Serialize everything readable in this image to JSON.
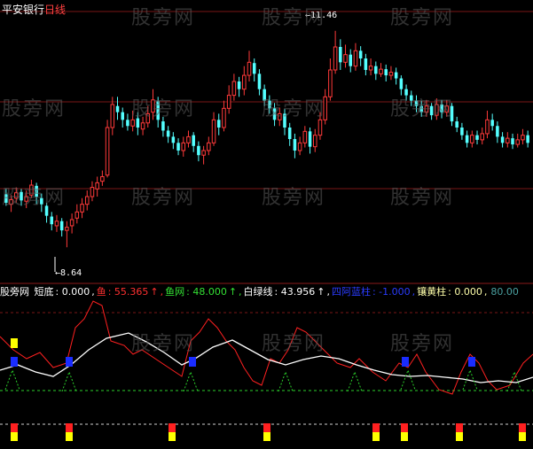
{
  "header": {
    "broker": "平安银行",
    "period": "日线"
  },
  "watermark": "股旁网",
  "colors": {
    "up": "#ff3a3a",
    "down": "#54ffff",
    "grid": "#7a1616",
    "white_line": "#ffffff",
    "green_dash": "#2bd12b",
    "yellow": "#ffff00",
    "blue": "#1a2cff",
    "red": "#ff2020"
  },
  "annotations": {
    "high": "11.46",
    "low": "8.64"
  },
  "indicator": {
    "name": "股旁网",
    "items": [
      {
        "label": "短底",
        "value": "0.000",
        "color": "#ffffff"
      },
      {
        "label": "鱼",
        "value": "55.365",
        "color": "#ff3030",
        "arrow": "↑"
      },
      {
        "label": "鱼网",
        "value": "48.000",
        "color": "#33e033",
        "arrow": "↑"
      },
      {
        "label": "白绿线",
        "value": "43.956",
        "color": "#ffffff",
        "arrow": "↑"
      },
      {
        "label": "四阿蓝柱",
        "value": "-1.000",
        "color": "#2a3cff"
      },
      {
        "label": "镶黄柱",
        "value": "0.000",
        "color": "#ffffaa"
      },
      {
        "label": "",
        "value": "80.00",
        "color": "#4aa0a0"
      }
    ]
  },
  "chart_data": {
    "type": "candlestick",
    "ylim": [
      8.4,
      11.7
    ],
    "annotations": [
      {
        "label": "11.46",
        "value": 11.46
      },
      {
        "label": "8.64",
        "value": 8.64
      }
    ],
    "candles": [
      [
        9.33,
        9.22,
        9.4,
        9.18
      ],
      [
        9.2,
        9.26,
        9.32,
        9.1
      ],
      [
        9.28,
        9.35,
        9.42,
        9.22
      ],
      [
        9.36,
        9.25,
        9.4,
        9.18
      ],
      [
        9.24,
        9.3,
        9.38,
        9.15
      ],
      [
        9.32,
        9.45,
        9.52,
        9.28
      ],
      [
        9.44,
        9.3,
        9.48,
        9.2
      ],
      [
        9.28,
        9.2,
        9.34,
        9.1
      ],
      [
        9.18,
        9.05,
        9.22,
        8.96
      ],
      [
        9.04,
        8.94,
        9.1,
        8.86
      ],
      [
        8.92,
        8.98,
        9.06,
        8.84
      ],
      [
        8.98,
        8.86,
        9.02,
        8.78
      ],
      [
        8.86,
        8.9,
        8.98,
        8.64
      ],
      [
        8.92,
        9.0,
        9.08,
        8.82
      ],
      [
        9.02,
        9.1,
        9.2,
        8.95
      ],
      [
        9.1,
        9.2,
        9.28,
        9.02
      ],
      [
        9.2,
        9.3,
        9.38,
        9.12
      ],
      [
        9.3,
        9.42,
        9.5,
        9.24
      ],
      [
        9.4,
        9.48,
        9.56,
        9.3
      ],
      [
        9.5,
        9.56,
        9.64,
        9.44
      ],
      [
        9.58,
        10.2,
        10.3,
        9.55
      ],
      [
        10.2,
        10.5,
        10.6,
        10.1
      ],
      [
        10.48,
        10.4,
        10.6,
        10.3
      ],
      [
        10.4,
        10.3,
        10.46,
        10.2
      ],
      [
        10.3,
        10.22,
        10.38,
        10.16
      ],
      [
        10.22,
        10.3,
        10.42,
        10.15
      ],
      [
        10.32,
        10.2,
        10.4,
        10.1
      ],
      [
        10.18,
        10.26,
        10.34,
        10.1
      ],
      [
        10.26,
        10.38,
        10.48,
        10.2
      ],
      [
        10.4,
        10.56,
        10.7,
        10.3
      ],
      [
        10.54,
        10.3,
        10.6,
        10.2
      ],
      [
        10.28,
        10.16,
        10.34,
        10.08
      ],
      [
        10.16,
        10.08,
        10.22,
        10.0
      ],
      [
        10.08,
        10.0,
        10.14,
        9.92
      ],
      [
        10.0,
        9.9,
        10.06,
        9.84
      ],
      [
        9.9,
        10.0,
        10.08,
        9.82
      ],
      [
        10.0,
        10.08,
        10.16,
        9.94
      ],
      [
        10.1,
        9.96,
        10.14,
        9.88
      ],
      [
        9.96,
        9.84,
        10.02,
        9.76
      ],
      [
        9.84,
        9.9,
        9.96,
        9.72
      ],
      [
        9.9,
        10.0,
        10.08,
        9.84
      ],
      [
        10.0,
        10.3,
        10.4,
        9.96
      ],
      [
        10.3,
        10.2,
        10.38,
        10.1
      ],
      [
        10.2,
        10.45,
        10.55,
        10.15
      ],
      [
        10.45,
        10.62,
        10.75,
        10.38
      ],
      [
        10.62,
        10.8,
        10.9,
        10.55
      ],
      [
        10.8,
        10.7,
        10.86,
        10.6
      ],
      [
        10.7,
        10.88,
        11.0,
        10.62
      ],
      [
        10.88,
        11.05,
        11.2,
        10.8
      ],
      [
        11.04,
        10.9,
        11.1,
        10.8
      ],
      [
        10.9,
        10.7,
        10.96,
        10.62
      ],
      [
        10.7,
        10.55,
        10.76,
        10.48
      ],
      [
        10.55,
        10.45,
        10.62,
        10.38
      ],
      [
        10.45,
        10.3,
        10.52,
        10.22
      ],
      [
        10.3,
        10.38,
        10.46,
        10.22
      ],
      [
        10.38,
        10.2,
        10.44,
        10.1
      ],
      [
        10.2,
        10.05,
        10.26,
        9.96
      ],
      [
        10.05,
        9.9,
        10.12,
        9.8
      ],
      [
        9.9,
        10.0,
        10.08,
        9.84
      ],
      [
        10.0,
        10.15,
        10.22,
        9.94
      ],
      [
        10.15,
        9.95,
        10.2,
        9.86
      ],
      [
        9.95,
        10.1,
        10.18,
        9.88
      ],
      [
        10.1,
        10.3,
        10.4,
        10.04
      ],
      [
        10.3,
        10.6,
        10.7,
        10.24
      ],
      [
        10.6,
        10.95,
        11.1,
        10.55
      ],
      [
        10.95,
        11.25,
        11.46,
        10.9
      ],
      [
        11.25,
        11.05,
        11.35,
        10.95
      ],
      [
        11.05,
        11.15,
        11.28,
        10.98
      ],
      [
        11.15,
        11.0,
        11.22,
        10.92
      ],
      [
        11.0,
        11.2,
        11.3,
        10.94
      ],
      [
        11.2,
        11.1,
        11.26,
        11.0
      ],
      [
        11.1,
        10.95,
        11.16,
        10.88
      ],
      [
        10.95,
        11.0,
        11.1,
        10.88
      ],
      [
        11.0,
        10.9,
        11.06,
        10.82
      ],
      [
        10.9,
        10.96,
        11.04,
        10.86
      ],
      [
        10.96,
        10.88,
        11.02,
        10.8
      ],
      [
        10.88,
        10.92,
        11.0,
        10.82
      ],
      [
        10.92,
        10.84,
        10.98,
        10.76
      ],
      [
        10.84,
        10.7,
        10.88,
        10.62
      ],
      [
        10.7,
        10.62,
        10.76,
        10.55
      ],
      [
        10.62,
        10.55,
        10.68,
        10.48
      ],
      [
        10.55,
        10.48,
        10.62,
        10.4
      ],
      [
        10.48,
        10.4,
        10.55,
        10.34
      ],
      [
        10.4,
        10.48,
        10.56,
        10.34
      ],
      [
        10.48,
        10.36,
        10.52,
        10.3
      ],
      [
        10.36,
        10.5,
        10.58,
        10.3
      ],
      [
        10.5,
        10.4,
        10.56,
        10.32
      ],
      [
        10.4,
        10.48,
        10.56,
        10.34
      ],
      [
        10.48,
        10.28,
        10.52,
        10.22
      ],
      [
        10.28,
        10.2,
        10.34,
        10.14
      ],
      [
        10.2,
        10.1,
        10.26,
        10.04
      ],
      [
        10.1,
        10.0,
        10.16,
        9.94
      ],
      [
        10.0,
        10.1,
        10.16,
        9.94
      ],
      [
        10.1,
        10.04,
        10.16,
        9.98
      ],
      [
        10.04,
        10.12,
        10.2,
        9.98
      ],
      [
        10.12,
        10.3,
        10.42,
        10.06
      ],
      [
        10.3,
        10.22,
        10.38,
        10.16
      ],
      [
        10.22,
        10.08,
        10.28,
        10.0
      ],
      [
        10.08,
        10.0,
        10.14,
        9.94
      ],
      [
        10.0,
        10.06,
        10.14,
        9.94
      ],
      [
        10.06,
        9.98,
        10.12,
        9.92
      ],
      [
        9.98,
        10.04,
        10.12,
        9.94
      ],
      [
        10.04,
        10.1,
        10.18,
        9.98
      ],
      [
        10.1,
        10.0,
        10.16,
        9.94
      ]
    ]
  }
}
